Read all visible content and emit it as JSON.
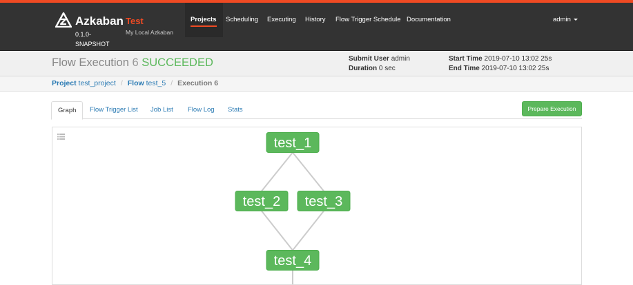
{
  "navbar": {
    "brand_name": "Azkaban",
    "version": "0.1.0-SNAPSHOT",
    "env_name": "Test",
    "env_desc": "My Local Azkaban",
    "items": [
      {
        "label": "Projects",
        "active": true
      },
      {
        "label": "Scheduling"
      },
      {
        "label": "Executing"
      },
      {
        "label": "History"
      },
      {
        "label": "Flow Trigger Schedule"
      },
      {
        "label": "Documentation"
      }
    ],
    "user": "admin"
  },
  "header": {
    "title": "Flow Execution",
    "exec_id": "6",
    "status": "SUCCEEDED",
    "submit_user_label": "Submit User",
    "submit_user": "admin",
    "duration_label": "Duration",
    "duration": "0 sec",
    "start_time_label": "Start Time",
    "start_time": "2019-07-10 13:02 25s",
    "end_time_label": "End Time",
    "end_time": "2019-07-10 13:02 25s",
    "status_color": "#5cb85c"
  },
  "breadcrumb": {
    "project_label": "Project",
    "project": "test_project",
    "flow_label": "Flow",
    "flow": "test_5",
    "current": "Execution 6"
  },
  "tabs": [
    {
      "label": "Graph",
      "active": true
    },
    {
      "label": "Flow Trigger List"
    },
    {
      "label": "Job List"
    },
    {
      "label": "Flow Log"
    },
    {
      "label": "Stats"
    }
  ],
  "actions": {
    "prepare_execution": "Prepare Execution"
  },
  "graph": {
    "nodes": [
      {
        "id": "test_1",
        "label": "test_1",
        "status": "SUCCEEDED"
      },
      {
        "id": "test_2",
        "label": "test_2",
        "status": "SUCCEEDED"
      },
      {
        "id": "test_3",
        "label": "test_3",
        "status": "SUCCEEDED"
      },
      {
        "id": "test_4",
        "label": "test_4",
        "status": "SUCCEEDED"
      }
    ],
    "edges": [
      {
        "from": "test_1",
        "to": "test_2"
      },
      {
        "from": "test_1",
        "to": "test_3"
      },
      {
        "from": "test_2",
        "to": "test_4"
      },
      {
        "from": "test_3",
        "to": "test_4"
      }
    ],
    "node_color": "#5cb85c",
    "edge_color": "#cccccc"
  },
  "colors": {
    "accent": "#ef4a23",
    "navbar": "#333333",
    "link": "#2a7ab3",
    "success": "#5cb85c"
  }
}
